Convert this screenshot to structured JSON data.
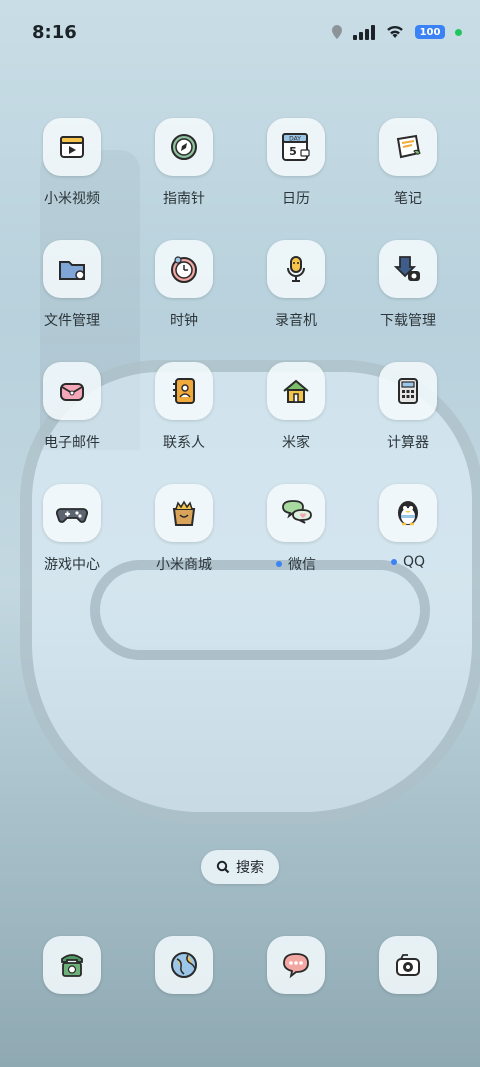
{
  "status": {
    "time": "8:16",
    "battery": "100"
  },
  "apps": [
    {
      "label": "小米视频",
      "icon": "video-icon"
    },
    {
      "label": "指南针",
      "icon": "compass-icon"
    },
    {
      "label": "日历",
      "icon": "calendar-icon",
      "calendar_top": "DAY",
      "calendar_day": "5"
    },
    {
      "label": "笔记",
      "icon": "notes-icon"
    },
    {
      "label": "文件管理",
      "icon": "folder-icon"
    },
    {
      "label": "时钟",
      "icon": "clock-icon"
    },
    {
      "label": "录音机",
      "icon": "microphone-icon"
    },
    {
      "label": "下载管理",
      "icon": "download-icon"
    },
    {
      "label": "电子邮件",
      "icon": "mail-icon"
    },
    {
      "label": "联系人",
      "icon": "contacts-icon"
    },
    {
      "label": "米家",
      "icon": "home-icon"
    },
    {
      "label": "计算器",
      "icon": "calculator-icon"
    },
    {
      "label": "游戏中心",
      "icon": "gamepad-icon"
    },
    {
      "label": "小米商城",
      "icon": "shopping-bag-icon"
    },
    {
      "label": "微信",
      "icon": "wechat-icon",
      "badge_dot": true
    },
    {
      "label": "QQ",
      "icon": "penguin-icon",
      "badge_dot": true
    }
  ],
  "search": {
    "label": "搜索"
  },
  "dock": [
    {
      "icon": "phone-icon"
    },
    {
      "icon": "browser-globe-icon"
    },
    {
      "icon": "messages-icon"
    },
    {
      "icon": "camera-icon"
    }
  ],
  "colors": {
    "badge_dot": "#3b82f6",
    "battery": "#3b82f6",
    "status_dot": "#22c55e"
  }
}
